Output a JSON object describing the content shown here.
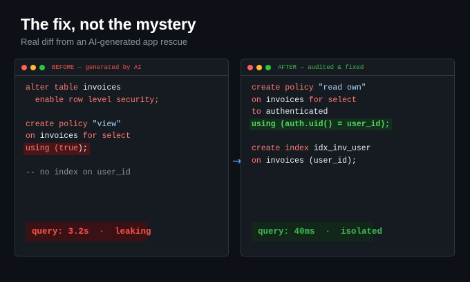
{
  "title": "The fix, not the mystery",
  "subtitle": "Real diff from an AI-generated app rescue",
  "before": {
    "label": "BEFORE — generated by AI",
    "lines": [
      [
        {
          "t": "alter table ",
          "c": "kw"
        },
        {
          "t": "invoices",
          "c": ""
        }
      ],
      [
        {
          "t": "  enable row level security;",
          "c": "kw"
        }
      ],
      [],
      [
        {
          "t": "create policy ",
          "c": "kw"
        },
        {
          "t": "\"view\"",
          "c": "str"
        }
      ],
      [
        {
          "t": "on ",
          "c": "kw"
        },
        {
          "t": "invoices ",
          "c": ""
        },
        {
          "t": "for select",
          "c": "kw"
        }
      ],
      [
        {
          "t": "using (",
          "c": "kw",
          "hl": "red"
        },
        {
          "t": "true",
          "c": "kw",
          "hl": "red"
        },
        {
          "t": ");",
          "c": "",
          "hl": "red"
        }
      ],
      [],
      [
        {
          "t": "-- no index on user_id",
          "c": "cm"
        }
      ]
    ],
    "status": "query: 3.2s  ·  leaking"
  },
  "after": {
    "label": "AFTER — audited & fixed",
    "lines": [
      [
        {
          "t": "create policy ",
          "c": "kw"
        },
        {
          "t": "\"read own\"",
          "c": "str"
        }
      ],
      [
        {
          "t": "on ",
          "c": "kw"
        },
        {
          "t": "invoices ",
          "c": ""
        },
        {
          "t": "for select",
          "c": "kw"
        }
      ],
      [
        {
          "t": "to ",
          "c": "kw"
        },
        {
          "t": "authenticated",
          "c": ""
        }
      ],
      [
        {
          "t": "using (auth.uid() = user_id);",
          "c": "fn-green",
          "hl": "green"
        }
      ],
      [],
      [
        {
          "t": "create index ",
          "c": "kw"
        },
        {
          "t": "idx_inv_user",
          "c": ""
        }
      ],
      [
        {
          "t": "on ",
          "c": "kw"
        },
        {
          "t": "invoices (user_id);",
          "c": ""
        }
      ]
    ],
    "status": "query: 40ms  ·  isolated"
  },
  "arrow": "→",
  "colors": {
    "background": "#0d1117",
    "panel": "#161b22",
    "keyword": "#ff7b72",
    "string": "#a5d6ff",
    "bad": "#f85149",
    "good": "#3fb950",
    "arrow": "#58a6ff"
  }
}
